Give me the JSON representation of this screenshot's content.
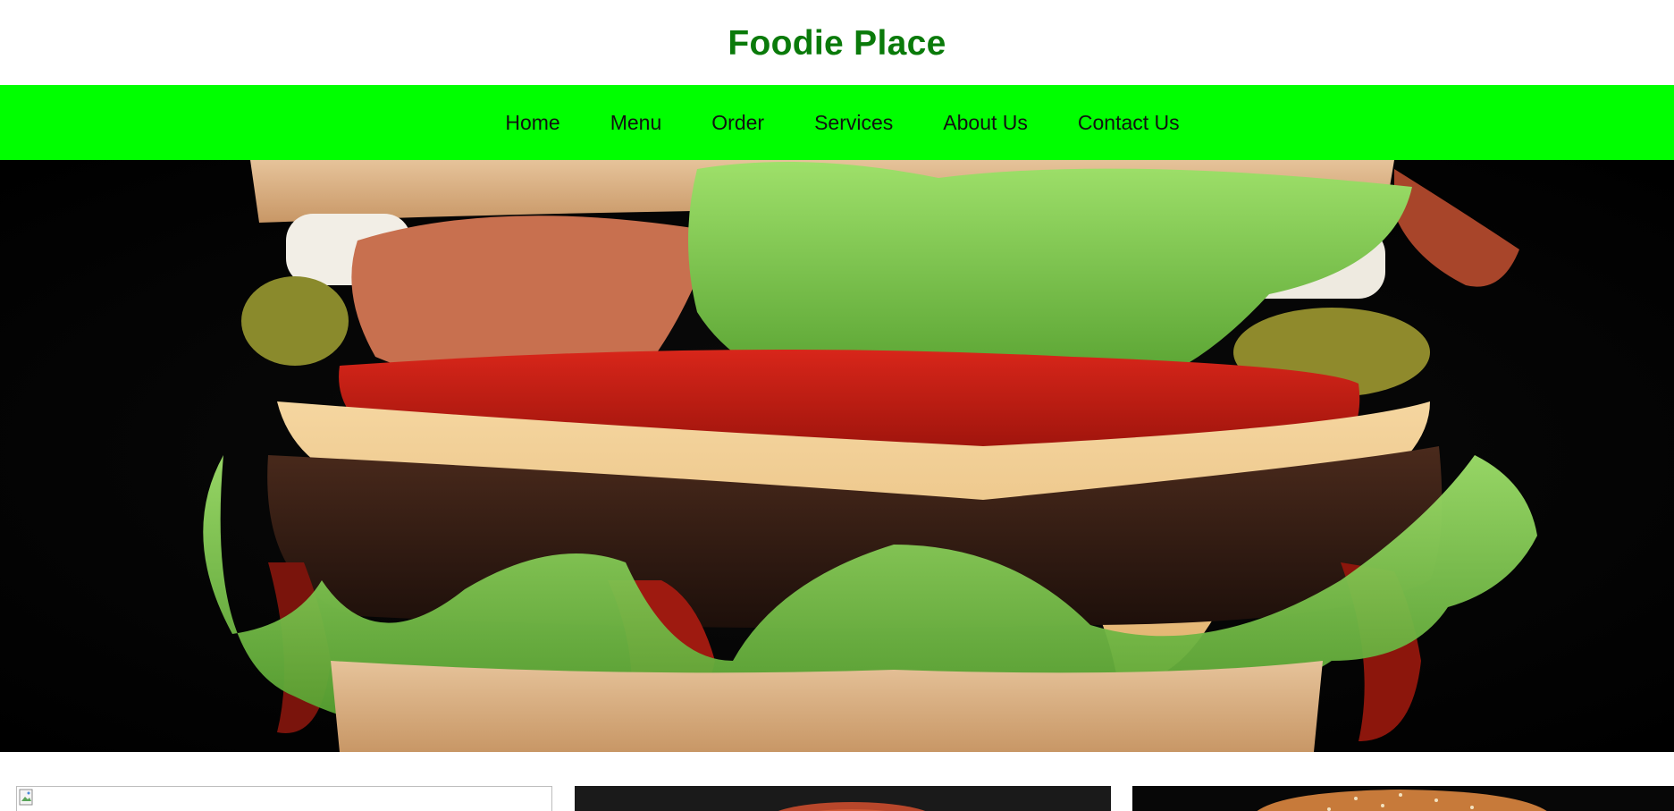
{
  "header": {
    "title": "Foodie Place"
  },
  "nav": {
    "items": [
      {
        "label": "Home"
      },
      {
        "label": "Menu"
      },
      {
        "label": "Order"
      },
      {
        "label": "Services"
      },
      {
        "label": "About Us"
      },
      {
        "label": "Contact Us"
      }
    ]
  },
  "colors": {
    "title": "#0a7a0a",
    "nav_background": "#00ff00",
    "nav_text": "#111111",
    "hero_background": "#020202"
  },
  "hero": {
    "image": "burger-photo-icon"
  },
  "cards": [
    {
      "image": "broken-image-icon"
    },
    {
      "image": "pizza-photo-icon"
    },
    {
      "image": "burger-bun-photo-icon"
    }
  ]
}
